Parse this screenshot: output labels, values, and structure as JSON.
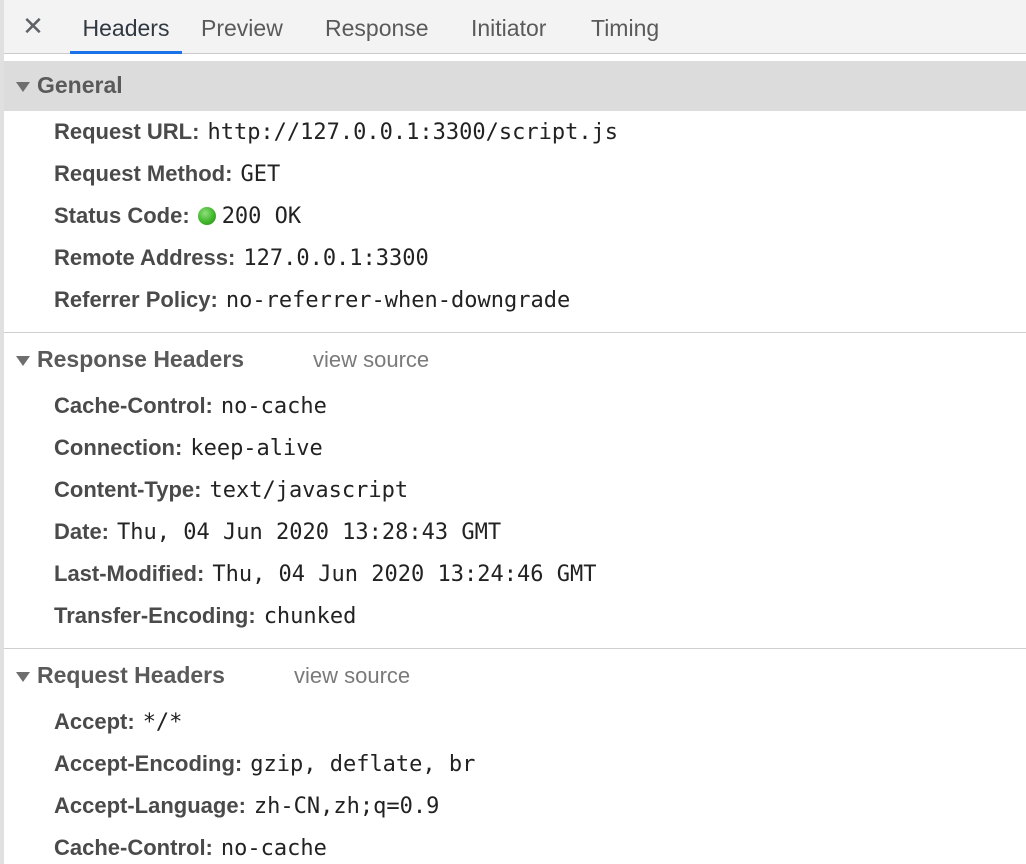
{
  "tabbar": {
    "close_icon": "close-icon",
    "tabs": [
      {
        "label": "Headers",
        "active": true
      },
      {
        "label": "Preview",
        "active": false
      },
      {
        "label": "Response",
        "active": false
      },
      {
        "label": "Initiator",
        "active": false
      },
      {
        "label": "Timing",
        "active": false
      }
    ]
  },
  "general": {
    "title": "General",
    "rows": [
      {
        "key": "Request URL:",
        "value": "http://127.0.0.1:3300/script.js"
      },
      {
        "key": "Request Method:",
        "value": "GET"
      },
      {
        "key": "Status Code:",
        "value": "200 OK",
        "status_color": "#3fb52a"
      },
      {
        "key": "Remote Address:",
        "value": "127.0.0.1:3300"
      },
      {
        "key": "Referrer Policy:",
        "value": "no-referrer-when-downgrade"
      }
    ]
  },
  "response_headers": {
    "title": "Response Headers",
    "view_source": "view source",
    "rows": [
      {
        "key": "Cache-Control:",
        "value": "no-cache"
      },
      {
        "key": "Connection:",
        "value": "keep-alive"
      },
      {
        "key": "Content-Type:",
        "value": "text/javascript"
      },
      {
        "key": "Date:",
        "value": "Thu, 04 Jun 2020 13:28:43 GMT"
      },
      {
        "key": "Last-Modified:",
        "value": "Thu, 04 Jun 2020 13:24:46 GMT"
      },
      {
        "key": "Transfer-Encoding:",
        "value": "chunked"
      }
    ]
  },
  "request_headers": {
    "title": "Request Headers",
    "view_source": "view source",
    "rows": [
      {
        "key": "Accept:",
        "value": "*/*"
      },
      {
        "key": "Accept-Encoding:",
        "value": "gzip, deflate, br"
      },
      {
        "key": "Accept-Language:",
        "value": "zh-CN,zh;q=0.9"
      },
      {
        "key": "Cache-Control:",
        "value": "no-cache"
      }
    ]
  },
  "colors": {
    "accent": "#1a73e8",
    "section_header_bg": "#dcdcdc",
    "tabbar_bg": "#f3f3f3"
  }
}
